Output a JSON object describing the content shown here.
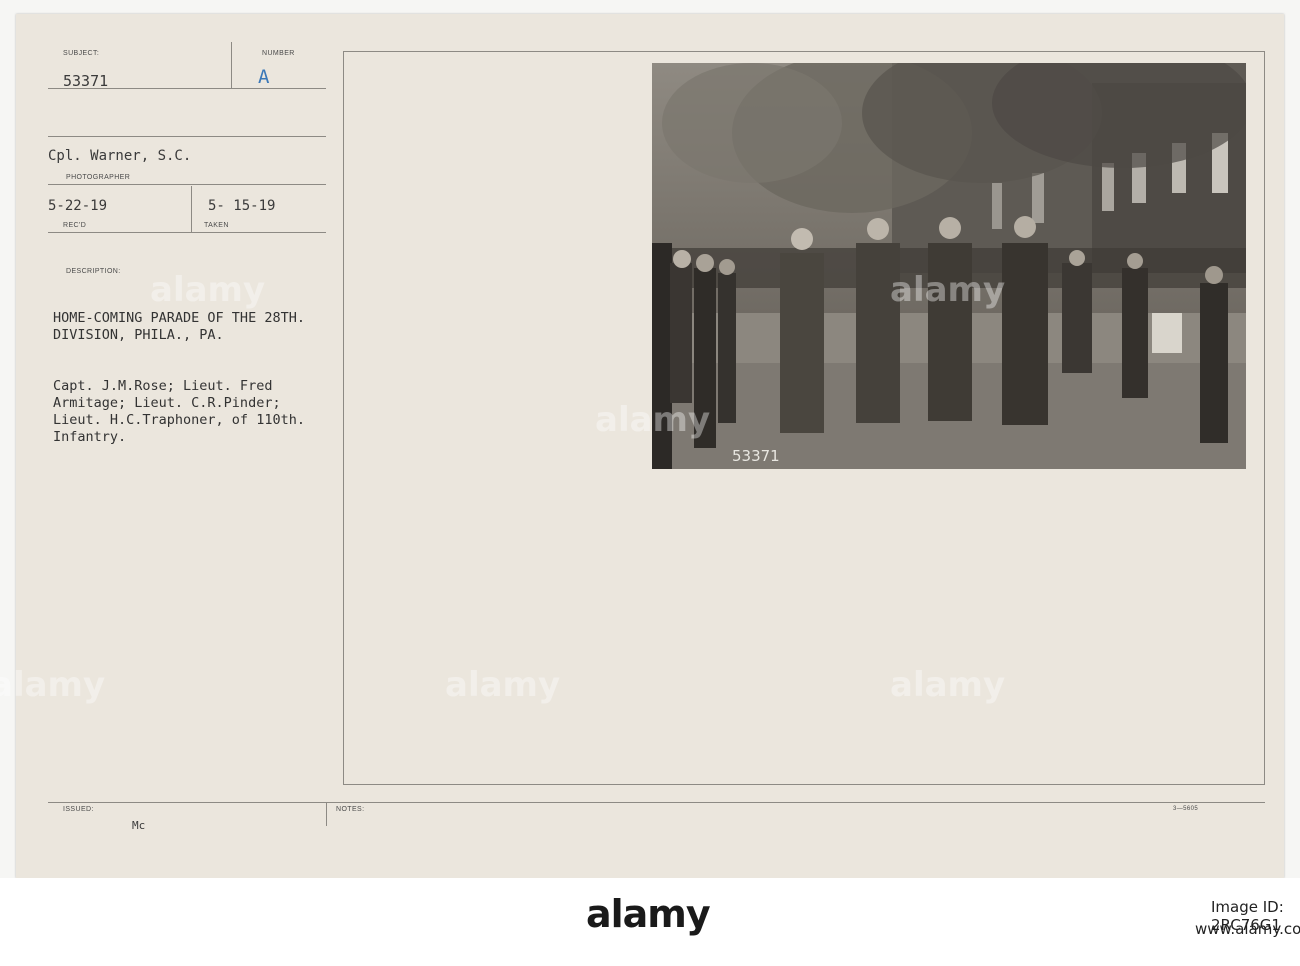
{
  "record": {
    "subject_label": "SUBJECT:",
    "subject": "53371",
    "number_label": "NUMBER",
    "number": "A",
    "photographer": "Cpl. Warner, S.C.",
    "photographer_label": "PHOTOGRAPHER",
    "received": "5-22-19",
    "received_label": "REC'D",
    "taken": "5- 15-19",
    "taken_label": "TAKEN",
    "description_label": "DESCRIPTION:",
    "description_title": "HOME-COMING PARADE OF THE 28TH.\nDIVISION, PHILA., PA.",
    "description_body": "Capt. J.M.Rose; Lieut. Fred\nArmitage; Lieut. C.R.Pinder;\nLieut. H.C.Traphoner, of 110th.\nInfantry.",
    "issued_label": "ISSUED:",
    "issued": "Mc",
    "notes_label": "NOTES:",
    "form_code": "3—5605"
  },
  "photo": {
    "negative_number": "53371"
  },
  "watermark": "alamy",
  "footer": {
    "brand": "alamy",
    "image_id": "Image ID: 2RC76G1",
    "stock_no": "www.alamy.com"
  }
}
